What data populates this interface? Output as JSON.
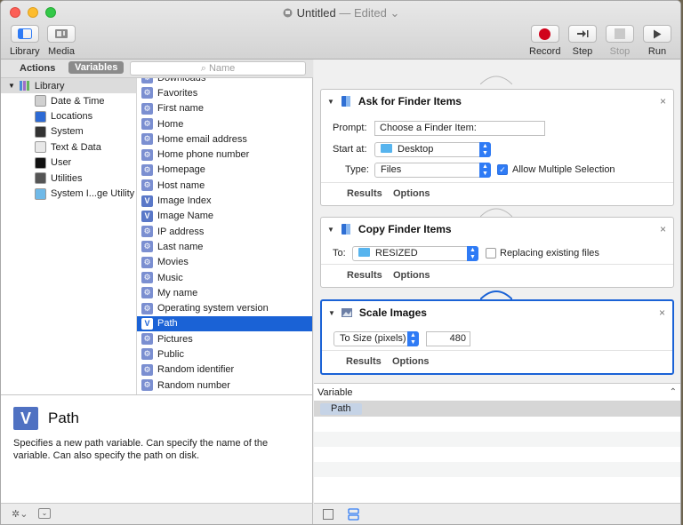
{
  "window": {
    "title": "Untitled",
    "edited": " — Edited",
    "title_chevron": "⌄"
  },
  "toolbar": {
    "library": "Library",
    "media": "Media",
    "record": "Record",
    "step": "Step",
    "stop": "Stop",
    "run": "Run"
  },
  "tabs": {
    "actions": "Actions",
    "variables": "Variables"
  },
  "search": {
    "placeholder": "Name"
  },
  "library": {
    "root": "Library",
    "items": [
      {
        "label": "Date & Time",
        "color": "#d0d0d0"
      },
      {
        "label": "Locations",
        "color": "#2d6ad4"
      },
      {
        "label": "System",
        "color": "#333333"
      },
      {
        "label": "Text & Data",
        "color": "#e8e8e8"
      },
      {
        "label": "User",
        "color": "#111111"
      },
      {
        "label": "Utilities",
        "color": "#555555"
      },
      {
        "label": "System I...ge Utility",
        "color": "#6fb9e8"
      }
    ]
  },
  "variables": [
    {
      "label": "Downloads",
      "v": false
    },
    {
      "label": "Favorites",
      "v": false
    },
    {
      "label": "First name",
      "v": false
    },
    {
      "label": "Home",
      "v": false
    },
    {
      "label": "Home email address",
      "v": false
    },
    {
      "label": "Home phone number",
      "v": false
    },
    {
      "label": "Homepage",
      "v": false
    },
    {
      "label": "Host name",
      "v": false
    },
    {
      "label": "Image Index",
      "v": true
    },
    {
      "label": "Image Name",
      "v": true
    },
    {
      "label": "IP address",
      "v": false
    },
    {
      "label": "Last name",
      "v": false
    },
    {
      "label": "Movies",
      "v": false
    },
    {
      "label": "Music",
      "v": false
    },
    {
      "label": "My name",
      "v": false
    },
    {
      "label": "Operating system version",
      "v": false
    },
    {
      "label": "Path",
      "v": true,
      "selected": true
    },
    {
      "label": "Pictures",
      "v": false
    },
    {
      "label": "Public",
      "v": false
    },
    {
      "label": "Random identifier",
      "v": false
    },
    {
      "label": "Random number",
      "v": false
    }
  ],
  "description": {
    "icon": "V",
    "title": "Path",
    "text": "Specifies a new path variable. Can specify the name of the variable. Can also specify the path on disk."
  },
  "actions": {
    "ask": {
      "title": "Ask for Finder Items",
      "prompt_label": "Prompt:",
      "prompt_value": "Choose a Finder Item:",
      "start_label": "Start at:",
      "start_value": "Desktop",
      "type_label": "Type:",
      "type_value": "Files",
      "allow_multiple": "Allow Multiple Selection"
    },
    "copy": {
      "title": "Copy Finder Items",
      "to_label": "To:",
      "to_value": "RESIZED",
      "replacing": "Replacing existing files"
    },
    "scale": {
      "title": "Scale Images",
      "mode_value": "To Size (pixels)",
      "size_value": "480"
    },
    "results": "Results",
    "options": "Options",
    "close": "×"
  },
  "var_table": {
    "header": "Variable",
    "rows": [
      "Path"
    ]
  },
  "bottom": {
    "gear": "✲⌄"
  },
  "colors": {
    "accent": "#1a62d6",
    "record": "#d0021b"
  }
}
